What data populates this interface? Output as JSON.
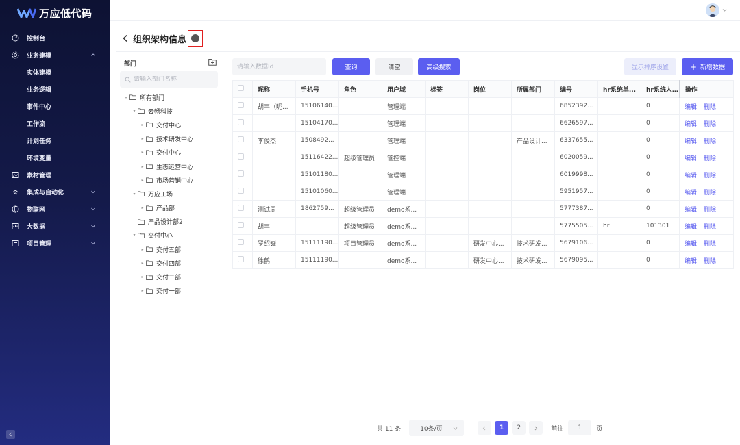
{
  "app": {
    "name": "万应低代码"
  },
  "sidebar": {
    "items": [
      {
        "label": "控制台",
        "icon": "dashboard-icon"
      },
      {
        "label": "业务建模",
        "icon": "gear-icon",
        "expanded": true,
        "children": [
          "实体建模",
          "业务逻辑",
          "事件中心",
          "工作流",
          "计划任务",
          "环境变量"
        ]
      },
      {
        "label": "素材管理",
        "icon": "image-icon"
      },
      {
        "label": "集成与自动化",
        "icon": "integration-icon"
      },
      {
        "label": "物联网",
        "icon": "globe-icon"
      },
      {
        "label": "大数据",
        "icon": "data-icon"
      },
      {
        "label": "项目管理",
        "icon": "project-icon"
      }
    ]
  },
  "page": {
    "title": "组织架构信息"
  },
  "dept": {
    "header": "部门",
    "search_placeholder": "请输入部门名称",
    "tree": [
      {
        "label": "所有部门",
        "level": 0,
        "arrow": "▾"
      },
      {
        "label": "云畅科技",
        "level": 1,
        "arrow": "▾"
      },
      {
        "label": "交付中心",
        "level": 2,
        "arrow": "▸"
      },
      {
        "label": "技术研发中心",
        "level": 2,
        "arrow": "▸"
      },
      {
        "label": "交付中心",
        "level": 2,
        "arrow": "▸"
      },
      {
        "label": "生态运营中心",
        "level": 2,
        "arrow": "▸"
      },
      {
        "label": "市场营销中心",
        "level": 2,
        "arrow": "▸"
      },
      {
        "label": "万应工场",
        "level": 1,
        "arrow": "▾"
      },
      {
        "label": "产品部",
        "level": 2,
        "arrow": "▸"
      },
      {
        "label": "产品设计部2",
        "level": 1,
        "arrow": ""
      },
      {
        "label": "交付中心",
        "level": 1,
        "arrow": "▾"
      },
      {
        "label": "交付五部",
        "level": 2,
        "arrow": "▸"
      },
      {
        "label": "交付四部",
        "level": 2,
        "arrow": "▸"
      },
      {
        "label": "交付二部",
        "level": 2,
        "arrow": "▸"
      },
      {
        "label": "交付一部",
        "level": 2,
        "arrow": "▸"
      }
    ]
  },
  "toolbar": {
    "data_id_placeholder": "请输入数据Id",
    "query": "查询",
    "clear": "清空",
    "advanced": "高级搜索",
    "sort_settings": "显示排序设置",
    "add": "新增数据"
  },
  "table": {
    "columns": [
      "昵称",
      "手机号",
      "角色",
      "用户域",
      "标签",
      "岗位",
      "所属部门",
      "编号",
      "hr系统单...",
      "hr系统人...",
      "操作"
    ],
    "rows": [
      [
        "胡丰（昵...",
        "15106140...",
        "",
        "管理端",
        "",
        "",
        "",
        "6852392...",
        "",
        "0"
      ],
      [
        "",
        "15104170...",
        "",
        "管理端",
        "",
        "",
        "",
        "6626597...",
        "",
        "0"
      ],
      [
        "李俊杰",
        "1508492...",
        "",
        "管理端",
        "",
        "",
        "产品设计...",
        "6337655...",
        "",
        "0"
      ],
      [
        "",
        "15116422...",
        "超级管理员",
        "管控端",
        "",
        "",
        "",
        "6020059...",
        "",
        "0"
      ],
      [
        "",
        "15101180...",
        "",
        "管理端",
        "",
        "",
        "",
        "6019998...",
        "",
        "0"
      ],
      [
        "",
        "15101060...",
        "",
        "管理端",
        "",
        "",
        "",
        "5951957...",
        "",
        "0"
      ],
      [
        "测试周",
        "1862759...",
        "超级管理员",
        "demo系...",
        "",
        "",
        "",
        "5777387...",
        "",
        "0"
      ],
      [
        "胡丰",
        "",
        "超级管理员",
        "demo系...",
        "",
        "",
        "",
        "5775505...",
        "hr",
        "101301"
      ],
      [
        "罗绍巍",
        "15111190...",
        "项目管理员",
        "demo系...",
        "",
        "研发中心...",
        "技术研发...",
        "5679106...",
        "",
        "0"
      ],
      [
        "徐鹤",
        "15111190...",
        "",
        "demo系...",
        "",
        "研发中心...",
        "技术研发...",
        "5679095...",
        "",
        "0"
      ]
    ],
    "edit_label": "编辑",
    "delete_label": "删除"
  },
  "pagination": {
    "total": "共 11 条",
    "page_size": "10条/页",
    "pages": [
      "1",
      "2"
    ],
    "current": "1",
    "goto_label": "前往",
    "goto_value": "1",
    "page_unit": "页"
  },
  "colors": {
    "primary": "#5b5ef0",
    "sidebar_top": "#0d1233",
    "sidebar_bottom": "#232c80"
  }
}
